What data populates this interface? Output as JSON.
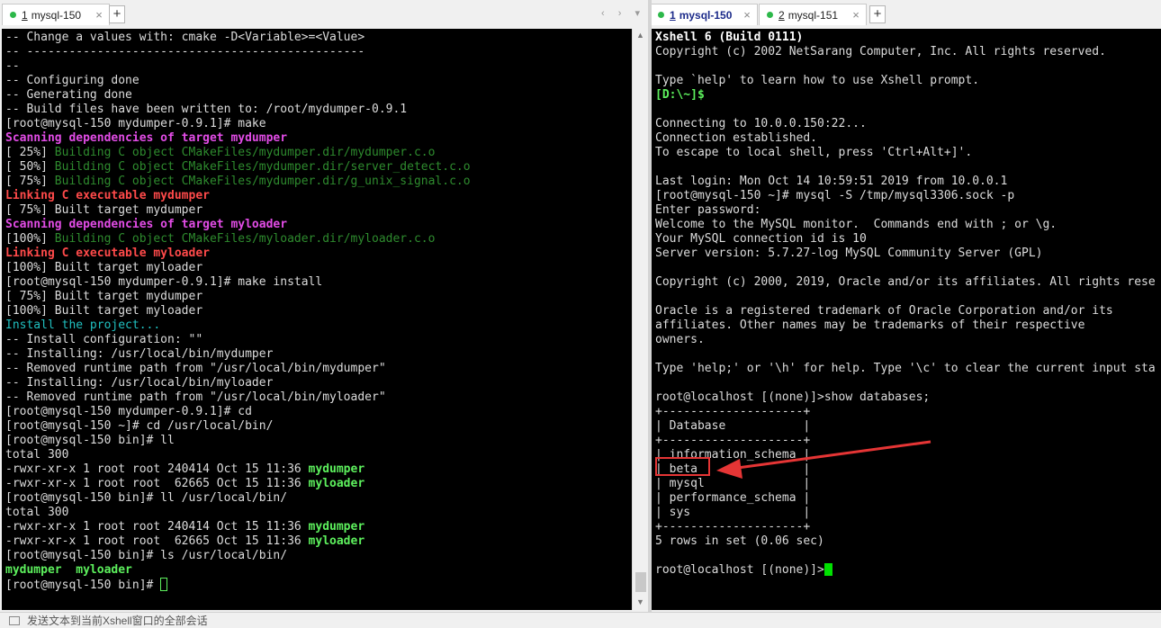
{
  "left_tabs": [
    {
      "num": "1",
      "label": " mysql-150"
    }
  ],
  "right_tabs": [
    {
      "num": "1",
      "label": " mysql-150"
    },
    {
      "num": "2",
      "label": " mysql-151"
    }
  ],
  "left_terminal": [
    [
      {
        "t": "-- Change a values with: cmake -D<Variable>=<Value>",
        "c": ""
      }
    ],
    [
      {
        "t": "-- ------------------------------------------------",
        "c": ""
      }
    ],
    [
      {
        "t": "--",
        "c": ""
      }
    ],
    [
      {
        "t": "-- Configuring done",
        "c": ""
      }
    ],
    [
      {
        "t": "-- Generating done",
        "c": ""
      }
    ],
    [
      {
        "t": "-- Build files have been written to: /root/mydumper-0.9.1",
        "c": ""
      }
    ],
    [
      {
        "t": "[root@mysql-150 mydumper-0.9.1]# make",
        "c": ""
      }
    ],
    [
      {
        "t": "Scanning dependencies of target mydumper",
        "c": "c-mag"
      }
    ],
    [
      {
        "t": "[ 25%] ",
        "c": ""
      },
      {
        "t": "Building C object CMakeFiles/mydumper.dir/mydumper.c.o",
        "c": "c-dgreen"
      }
    ],
    [
      {
        "t": "[ 50%] ",
        "c": ""
      },
      {
        "t": "Building C object CMakeFiles/mydumper.dir/server_detect.c.o",
        "c": "c-dgreen"
      }
    ],
    [
      {
        "t": "[ 75%] ",
        "c": ""
      },
      {
        "t": "Building C object CMakeFiles/mydumper.dir/g_unix_signal.c.o",
        "c": "c-dgreen"
      }
    ],
    [
      {
        "t": "Linking C executable mydumper",
        "c": "c-red"
      }
    ],
    [
      {
        "t": "[ 75%] Built target mydumper",
        "c": ""
      }
    ],
    [
      {
        "t": "Scanning dependencies of target myloader",
        "c": "c-mag"
      }
    ],
    [
      {
        "t": "[100%] ",
        "c": ""
      },
      {
        "t": "Building C object CMakeFiles/myloader.dir/myloader.c.o",
        "c": "c-dgreen"
      }
    ],
    [
      {
        "t": "Linking C executable myloader",
        "c": "c-red"
      }
    ],
    [
      {
        "t": "[100%] Built target myloader",
        "c": ""
      }
    ],
    [
      {
        "t": "[root@mysql-150 mydumper-0.9.1]# make install",
        "c": ""
      }
    ],
    [
      {
        "t": "[ 75%] Built target mydumper",
        "c": ""
      }
    ],
    [
      {
        "t": "[100%] Built target myloader",
        "c": ""
      }
    ],
    [
      {
        "t": "Install the project...",
        "c": "c-cyan"
      }
    ],
    [
      {
        "t": "-- Install configuration: \"\"",
        "c": ""
      }
    ],
    [
      {
        "t": "-- Installing: /usr/local/bin/mydumper",
        "c": ""
      }
    ],
    [
      {
        "t": "-- Removed runtime path from \"/usr/local/bin/mydumper\"",
        "c": ""
      }
    ],
    [
      {
        "t": "-- Installing: /usr/local/bin/myloader",
        "c": ""
      }
    ],
    [
      {
        "t": "-- Removed runtime path from \"/usr/local/bin/myloader\"",
        "c": ""
      }
    ],
    [
      {
        "t": "[root@mysql-150 mydumper-0.9.1]# cd",
        "c": ""
      }
    ],
    [
      {
        "t": "[root@mysql-150 ~]# cd /usr/local/bin/",
        "c": ""
      }
    ],
    [
      {
        "t": "[root@mysql-150 bin]# ll",
        "c": ""
      }
    ],
    [
      {
        "t": "total 300",
        "c": ""
      }
    ],
    [
      {
        "t": "-rwxr-xr-x 1 root root 240414 Oct 15 11:36 ",
        "c": ""
      },
      {
        "t": "mydumper",
        "c": "c-green"
      }
    ],
    [
      {
        "t": "-rwxr-xr-x 1 root root  62665 Oct 15 11:36 ",
        "c": ""
      },
      {
        "t": "myloader",
        "c": "c-green"
      }
    ],
    [
      {
        "t": "[root@mysql-150 bin]# ll /usr/local/bin/",
        "c": ""
      }
    ],
    [
      {
        "t": "total 300",
        "c": ""
      }
    ],
    [
      {
        "t": "-rwxr-xr-x 1 root root 240414 Oct 15 11:36 ",
        "c": ""
      },
      {
        "t": "mydumper",
        "c": "c-green"
      }
    ],
    [
      {
        "t": "-rwxr-xr-x 1 root root  62665 Oct 15 11:36 ",
        "c": ""
      },
      {
        "t": "myloader",
        "c": "c-green"
      }
    ],
    [
      {
        "t": "[root@mysql-150 bin]# ls /usr/local/bin/",
        "c": ""
      }
    ],
    [
      {
        "t": "mydumper  myloader",
        "c": "c-green"
      }
    ],
    [
      {
        "t": "[root@mysql-150 bin]# ",
        "c": ""
      },
      {
        "t": "",
        "c": "cursor-outline"
      }
    ]
  ],
  "right_terminal": [
    [
      {
        "t": "Xshell 6 (Build 0111)",
        "c": "c-white"
      }
    ],
    [
      {
        "t": "Copyright (c) 2002 NetSarang Computer, Inc. All rights reserved.",
        "c": ""
      }
    ],
    [
      {
        "t": "",
        "c": ""
      }
    ],
    [
      {
        "t": "Type `help' to learn how to use Xshell prompt.",
        "c": ""
      }
    ],
    [
      {
        "t": "[D:\\~]$",
        "c": "c-green"
      }
    ],
    [
      {
        "t": "",
        "c": ""
      }
    ],
    [
      {
        "t": "Connecting to 10.0.0.150:22...",
        "c": ""
      }
    ],
    [
      {
        "t": "Connection established.",
        "c": ""
      }
    ],
    [
      {
        "t": "To escape to local shell, press 'Ctrl+Alt+]'.",
        "c": ""
      }
    ],
    [
      {
        "t": "",
        "c": ""
      }
    ],
    [
      {
        "t": "Last login: Mon Oct 14 10:59:51 2019 from 10.0.0.1",
        "c": ""
      }
    ],
    [
      {
        "t": "[root@mysql-150 ~]# mysql -S /tmp/mysql3306.sock -p",
        "c": ""
      }
    ],
    [
      {
        "t": "Enter password:",
        "c": ""
      }
    ],
    [
      {
        "t": "Welcome to the MySQL monitor.  Commands end with ; or \\g.",
        "c": ""
      }
    ],
    [
      {
        "t": "Your MySQL connection id is 10",
        "c": ""
      }
    ],
    [
      {
        "t": "Server version: 5.7.27-log MySQL Community Server (GPL)",
        "c": ""
      }
    ],
    [
      {
        "t": "",
        "c": ""
      }
    ],
    [
      {
        "t": "Copyright (c) 2000, 2019, Oracle and/or its affiliates. All rights rese",
        "c": ""
      }
    ],
    [
      {
        "t": "",
        "c": ""
      }
    ],
    [
      {
        "t": "Oracle is a registered trademark of Oracle Corporation and/or its",
        "c": ""
      }
    ],
    [
      {
        "t": "affiliates. Other names may be trademarks of their respective",
        "c": ""
      }
    ],
    [
      {
        "t": "owners.",
        "c": ""
      }
    ],
    [
      {
        "t": "",
        "c": ""
      }
    ],
    [
      {
        "t": "Type 'help;' or '\\h' for help. Type '\\c' to clear the current input sta",
        "c": ""
      }
    ],
    [
      {
        "t": "",
        "c": ""
      }
    ],
    [
      {
        "t": "root@localhost [(none)]>show databases;",
        "c": ""
      }
    ],
    [
      {
        "t": "+--------------------+",
        "c": ""
      }
    ],
    [
      {
        "t": "| Database           |",
        "c": ""
      }
    ],
    [
      {
        "t": "+--------------------+",
        "c": ""
      }
    ],
    [
      {
        "t": "| information_schema |",
        "c": ""
      }
    ],
    [
      {
        "t": "| beta               |",
        "c": ""
      }
    ],
    [
      {
        "t": "| mysql              |",
        "c": ""
      }
    ],
    [
      {
        "t": "| performance_schema |",
        "c": ""
      }
    ],
    [
      {
        "t": "| sys                |",
        "c": ""
      }
    ],
    [
      {
        "t": "+--------------------+",
        "c": ""
      }
    ],
    [
      {
        "t": "5 rows in set (0.06 sec)",
        "c": ""
      }
    ],
    [
      {
        "t": "",
        "c": ""
      }
    ],
    [
      {
        "t": "root@localhost [(none)]>",
        "c": ""
      },
      {
        "t": "",
        "c": "cursor-block"
      }
    ]
  ],
  "statusbar": {
    "text": "发送文本到当前Xshell窗口的全部会话"
  },
  "colors": {
    "annotation": "#e53535",
    "terminal_bg": "#000000",
    "green": "#5df05d"
  }
}
